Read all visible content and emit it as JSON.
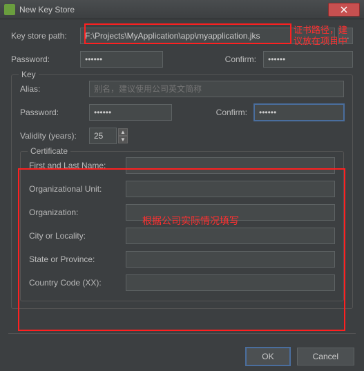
{
  "title": "New Key Store",
  "path": {
    "label": "Key store path:",
    "value": "F:\\Projects\\MyApplication\\app\\myapplication.jks"
  },
  "ks_password": {
    "label": "Password:",
    "value": "••••••",
    "confirm_label": "Confirm:",
    "confirm_value": "••••••"
  },
  "key_section": "Key",
  "alias": {
    "label": "Alias:",
    "placeholder": "别名，建议使用公司英文简称"
  },
  "key_password": {
    "label": "Password:",
    "value": "••••••",
    "confirm_label": "Confirm:",
    "confirm_value": "••••••"
  },
  "validity": {
    "label": "Validity (years):",
    "value": "25"
  },
  "cert_section": "Certificate",
  "cert": {
    "first_last": "First and Last Name:",
    "org_unit": "Organizational Unit:",
    "org": "Organization:",
    "city": "City or Locality:",
    "state": "State or Province:",
    "country": "Country Code (XX):"
  },
  "buttons": {
    "ok": "OK",
    "cancel": "Cancel"
  },
  "annotations": {
    "path_note": "证书路径，建议放在项目中",
    "cert_note": "根据公司实际情况填写"
  }
}
